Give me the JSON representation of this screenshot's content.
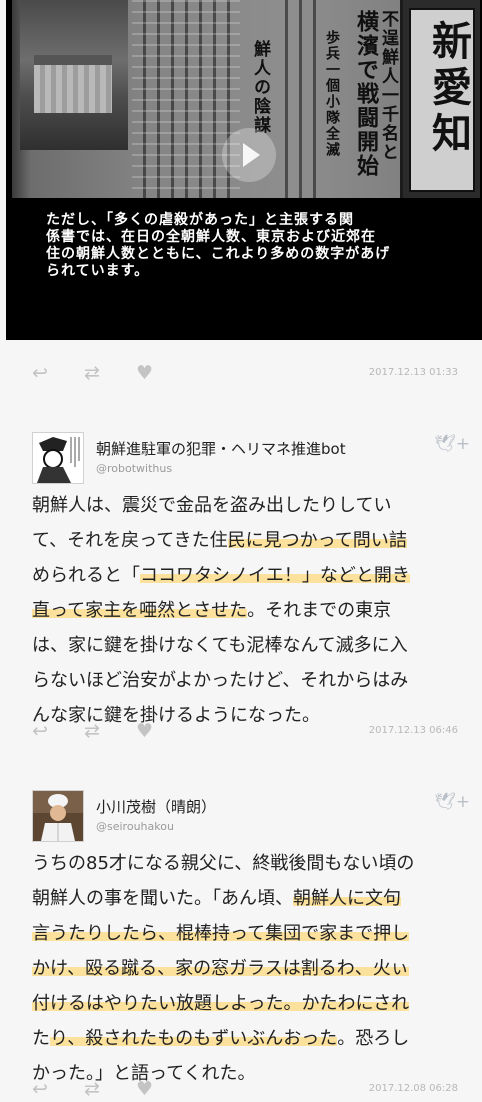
{
  "video": {
    "headlines": [
      "不逞鮮人一千名と",
      "横濱で戦闘開始",
      "歩兵一個小隊全滅",
      "鮮人の陰謀"
    ],
    "masthead": "新愛知",
    "caption_lines": [
      "ただし、「多くの虐殺があった」と主張する関",
      "係書では、在日の全朝鮮人数、東京および近郊在",
      "住の朝鮮人数とともに、これより多めの数字があげ",
      "られています。"
    ]
  },
  "icons": {
    "reply": "reply-icon",
    "retweet": "retweet-icon",
    "like": "heart-icon",
    "follow": "twitter-bird-follow-icon"
  },
  "tweets": [
    {
      "timestamp": "2017.12.13 01:33"
    },
    {
      "name": "朝鮮進駐軍の犯罪・ヘリマネ推進bot",
      "handle": "@robotwithus",
      "timestamp": "2017.12.13 06:46",
      "lines": [
        [
          {
            "t": "朝鮮人は、震災で金品を盗み出したりしてい"
          }
        ],
        [
          {
            "t": "て、それを戻ってきた住"
          },
          {
            "t": "民に見つかって問い詰",
            "hl": true
          }
        ],
        [
          {
            "t": "められると「"
          },
          {
            "t": "ココワタシノイエ！」などと開き",
            "hl": true
          }
        ],
        [
          {
            "t": "直って家主を唖然とさせた",
            "hl": true
          },
          {
            "t": "。それまでの東京"
          }
        ],
        [
          {
            "t": "は、家に鍵を掛けなくても泥棒なんて滅多に入"
          }
        ],
        [
          {
            "t": "らないほど治安がよかったけど、それからはみ"
          }
        ],
        [
          {
            "t": "んな家に鍵を掛けるようになった。"
          }
        ]
      ]
    },
    {
      "name": "小川茂樹（晴朗）",
      "handle": "@seirouhakou",
      "timestamp": "2017.12.08 06:28",
      "lines": [
        [
          {
            "t": "うちの85才になる親父に、終戦後間もない頃の"
          }
        ],
        [
          {
            "t": "朝鮮人の事を聞いた。「あん頃、"
          },
          {
            "t": "朝鮮人に文句",
            "hl": true
          }
        ],
        [
          {
            "t": "言うたりしたら、棍棒持って集団で家まで押し",
            "hl": true
          }
        ],
        [
          {
            "t": "かけ、殴る蹴る、家の窓ガラスは割るわ、火ぃ",
            "hl": true
          }
        ],
        [
          {
            "t": "付けるはやりたい放題しよった。かたわにされ",
            "hl": true
          }
        ],
        [
          {
            "t": "た",
            "hl": false
          },
          {
            "t": "り、殺されたものもずいぶんおった",
            "hl": true
          },
          {
            "t": "。恐ろし"
          }
        ],
        [
          {
            "t": "かった。」と語ってくれた。"
          }
        ]
      ]
    }
  ]
}
